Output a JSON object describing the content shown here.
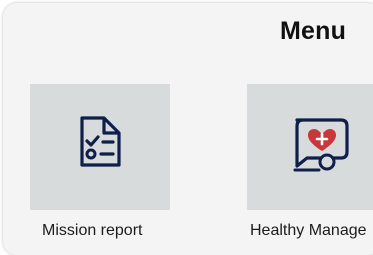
{
  "header": {
    "title": "Menu"
  },
  "menu": {
    "items": [
      {
        "label": "Mission report",
        "icon": "clipboard-checklist-icon"
      },
      {
        "label": "Healthy Manage",
        "icon": "health-chat-icon"
      }
    ]
  },
  "colors": {
    "background": "#f4f4f4",
    "tile": "#d8dbdc",
    "icon": "#0f1f4a",
    "heart": "#c9373c"
  }
}
